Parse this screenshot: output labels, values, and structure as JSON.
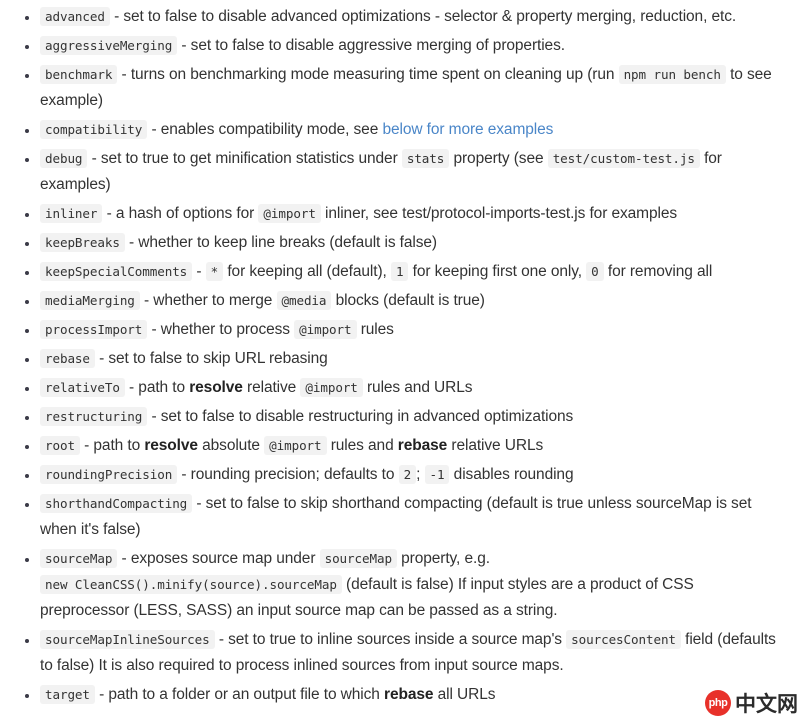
{
  "page": {
    "kind": "documentation-options-list",
    "link_color": "#4a86c8",
    "code_bg_color": "#f2f2f2",
    "text_color": "#333333"
  },
  "options": [
    {
      "name": "advanced",
      "parts": [
        {
          "type": "text",
          "value": " - set to false to disable advanced optimizations - selector & property merging, reduction, etc."
        }
      ]
    },
    {
      "name": "aggressiveMerging",
      "parts": [
        {
          "type": "text",
          "value": " - set to false to disable aggressive merging of properties."
        }
      ]
    },
    {
      "name": "benchmark",
      "parts": [
        {
          "type": "text",
          "value": " - turns on benchmarking mode measuring time spent on cleaning up (run "
        },
        {
          "type": "code",
          "value": "npm run bench"
        },
        {
          "type": "text",
          "value": " to see example)"
        }
      ]
    },
    {
      "name": "compatibility",
      "parts": [
        {
          "type": "text",
          "value": " - enables compatibility mode, see "
        },
        {
          "type": "link",
          "value": "below for more examples"
        }
      ]
    },
    {
      "name": "debug",
      "parts": [
        {
          "type": "text",
          "value": " - set to true to get minification statistics under "
        },
        {
          "type": "code",
          "value": "stats"
        },
        {
          "type": "text",
          "value": " property (see "
        },
        {
          "type": "code",
          "value": "test/custom-test.js"
        },
        {
          "type": "text",
          "value": " for examples)"
        }
      ]
    },
    {
      "name": "inliner",
      "parts": [
        {
          "type": "text",
          "value": " - a hash of options for "
        },
        {
          "type": "code",
          "value": "@import"
        },
        {
          "type": "text",
          "value": " inliner, see test/protocol-imports-test.js for examples"
        }
      ]
    },
    {
      "name": "keepBreaks",
      "parts": [
        {
          "type": "text",
          "value": " - whether to keep line breaks (default is false)"
        }
      ]
    },
    {
      "name": "keepSpecialComments",
      "parts": [
        {
          "type": "text",
          "value": " - "
        },
        {
          "type": "code",
          "value": "*"
        },
        {
          "type": "text",
          "value": " for keeping all (default), "
        },
        {
          "type": "code",
          "value": "1"
        },
        {
          "type": "text",
          "value": " for keeping first one only, "
        },
        {
          "type": "code",
          "value": "0"
        },
        {
          "type": "text",
          "value": " for removing all"
        }
      ]
    },
    {
      "name": "mediaMerging",
      "parts": [
        {
          "type": "text",
          "value": " - whether to merge "
        },
        {
          "type": "code",
          "value": "@media"
        },
        {
          "type": "text",
          "value": " blocks (default is true)"
        }
      ]
    },
    {
      "name": "processImport",
      "parts": [
        {
          "type": "text",
          "value": " - whether to process "
        },
        {
          "type": "code",
          "value": "@import"
        },
        {
          "type": "text",
          "value": " rules"
        }
      ]
    },
    {
      "name": "rebase",
      "parts": [
        {
          "type": "text",
          "value": " - set to false to skip URL rebasing"
        }
      ]
    },
    {
      "name": "relativeTo",
      "parts": [
        {
          "type": "text",
          "value": " - path to "
        },
        {
          "type": "bold",
          "value": "resolve"
        },
        {
          "type": "text",
          "value": " relative "
        },
        {
          "type": "code",
          "value": "@import"
        },
        {
          "type": "text",
          "value": " rules and URLs"
        }
      ]
    },
    {
      "name": "restructuring",
      "parts": [
        {
          "type": "text",
          "value": " - set to false to disable restructuring in advanced optimizations"
        }
      ]
    },
    {
      "name": "root",
      "parts": [
        {
          "type": "text",
          "value": " - path to "
        },
        {
          "type": "bold",
          "value": "resolve"
        },
        {
          "type": "text",
          "value": " absolute "
        },
        {
          "type": "code",
          "value": "@import"
        },
        {
          "type": "text",
          "value": " rules and "
        },
        {
          "type": "bold",
          "value": "rebase"
        },
        {
          "type": "text",
          "value": " relative URLs"
        }
      ]
    },
    {
      "name": "roundingPrecision",
      "parts": [
        {
          "type": "text",
          "value": " - rounding precision; defaults to "
        },
        {
          "type": "code",
          "value": "2"
        },
        {
          "type": "text",
          "value": "; "
        },
        {
          "type": "code",
          "value": "-1"
        },
        {
          "type": "text",
          "value": " disables rounding"
        }
      ]
    },
    {
      "name": "shorthandCompacting",
      "parts": [
        {
          "type": "text",
          "value": " - set to false to skip shorthand compacting (default is true unless sourceMap is set when it's false)"
        }
      ]
    },
    {
      "name": "sourceMap",
      "parts": [
        {
          "type": "text",
          "value": " - exposes source map under "
        },
        {
          "type": "code",
          "value": "sourceMap"
        },
        {
          "type": "text",
          "value": " property, e.g. "
        },
        {
          "type": "code",
          "value": "new CleanCSS().minify(source).sourceMap"
        },
        {
          "type": "text",
          "value": " (default is false) If input styles are a product of CSS preprocessor (LESS, SASS) an input source map can be passed as a string."
        }
      ]
    },
    {
      "name": "sourceMapInlineSources",
      "parts": [
        {
          "type": "text",
          "value": " - set to true to inline sources inside a source map's "
        },
        {
          "type": "code",
          "value": "sourcesContent"
        },
        {
          "type": "text",
          "value": " field (defaults to false) It is also required to process inlined sources from input source maps."
        }
      ]
    },
    {
      "name": "target",
      "parts": [
        {
          "type": "text",
          "value": " - path to a folder or an output file to which "
        },
        {
          "type": "bold",
          "value": "rebase"
        },
        {
          "type": "text",
          "value": " all URLs"
        }
      ]
    }
  ],
  "watermark": {
    "badge_label": "php",
    "text": "中文网",
    "badge_color": "#e8312a"
  }
}
